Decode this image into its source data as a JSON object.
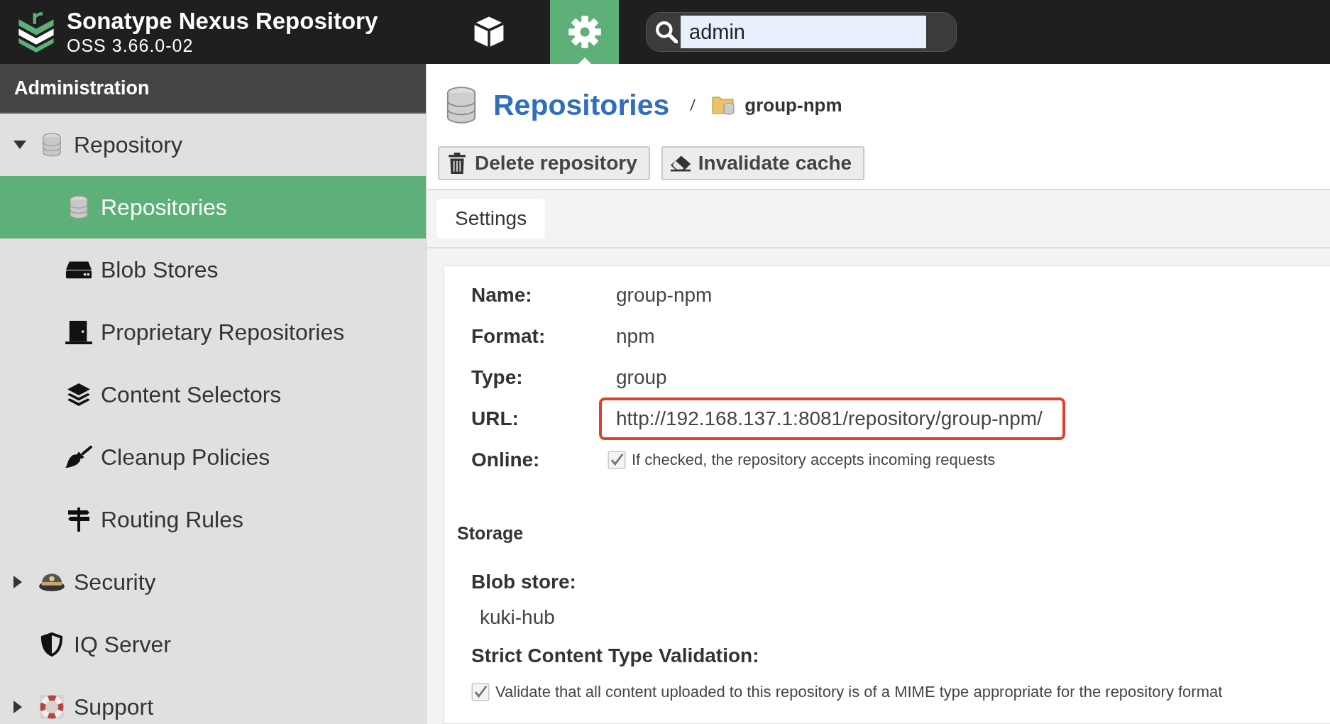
{
  "header": {
    "product": "Sonatype Nexus Repository",
    "version": "OSS 3.66.0-02"
  },
  "nav_buttons": [
    {
      "kind": "browse",
      "selected": false
    },
    {
      "kind": "admin",
      "selected": true
    }
  ],
  "search": {
    "value": "admin"
  },
  "sidebar": {
    "title": "Administration",
    "items": [
      {
        "label": "Repository",
        "kind": "database",
        "expanded": true,
        "selected": false,
        "children": [
          {
            "label": "Repositories",
            "kind": "database",
            "selected": true
          },
          {
            "label": "Blob Stores",
            "kind": "drive",
            "selected": false
          },
          {
            "label": "Proprietary Repositories",
            "kind": "door",
            "selected": false
          },
          {
            "label": "Content Selectors",
            "kind": "layers",
            "selected": false
          },
          {
            "label": "Cleanup Policies",
            "kind": "brush",
            "selected": false
          },
          {
            "label": "Routing Rules",
            "kind": "signpost",
            "selected": false
          }
        ]
      },
      {
        "label": "Security",
        "kind": "cap",
        "expanded": false,
        "selected": false
      },
      {
        "label": "IQ Server",
        "kind": "shield",
        "selected": false
      },
      {
        "label": "Support",
        "kind": "lifebuoy",
        "expanded": false,
        "selected": false
      }
    ]
  },
  "breadcrumb": {
    "title": "Repositories",
    "current": "group-npm"
  },
  "actions": [
    {
      "label": "Delete repository",
      "kind": "trash"
    },
    {
      "label": "Invalidate cache",
      "kind": "eraser"
    }
  ],
  "tabs": [
    {
      "label": "Settings",
      "selected": true
    }
  ],
  "fields": [
    {
      "kind": "text",
      "label": "Name:",
      "value": "group-npm",
      "highlighted": false
    },
    {
      "kind": "text",
      "label": "Format:",
      "value": "npm",
      "highlighted": false
    },
    {
      "kind": "text",
      "label": "Type:",
      "value": "group",
      "highlighted": false
    },
    {
      "kind": "text",
      "label": "URL:",
      "value": "http://192.168.137.1:8081/repository/group-npm/",
      "highlighted": true
    },
    {
      "kind": "checkbox",
      "label": "Online:",
      "checked": true,
      "hint": "If checked, the repository accepts incoming requests"
    }
  ],
  "storage": {
    "title": "Storage",
    "fields": [
      {
        "kind": "text",
        "label": "Blob store:",
        "value": "kuki-hub"
      },
      {
        "kind": "checkbox",
        "label": "Strict Content Type Validation:",
        "checked": true,
        "hint": "Validate that all content uploaded to this repository is of a MIME type appropriate for the repository format"
      }
    ]
  }
}
